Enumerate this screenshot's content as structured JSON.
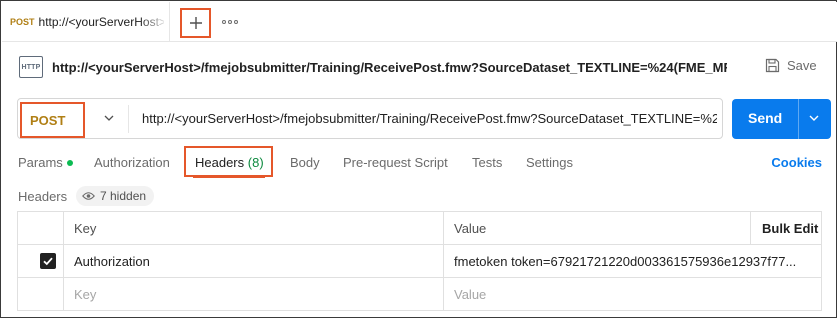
{
  "tab": {
    "method": "POST",
    "url": "http://<yourServerHost>/fmejobsubmitter/Training/ReceivePost.fmw"
  },
  "request": {
    "icon_label": "HTTP",
    "name": "http://<yourServerHost>/fmejobsubmitter/Training/ReceivePost.fmw?SourceDataset_TEXTLINE=%24(FME_MF_DI...",
    "save_label": "Save"
  },
  "urlbar": {
    "method": "POST",
    "url": "http://<yourServerHost>/fmejobsubmitter/Training/ReceivePost.fmw?SourceDataset_TEXTLINE=%2..."
  },
  "send_label": "Send",
  "req_tabs": {
    "params": "Params",
    "authorization": "Authorization",
    "headers": "Headers",
    "headers_count": "(8)",
    "body": "Body",
    "prerequest": "Pre-request Script",
    "tests": "Tests",
    "settings": "Settings",
    "cookies": "Cookies"
  },
  "headers_section": {
    "title": "Headers",
    "hidden": "7 hidden"
  },
  "table": {
    "columns": {
      "key": "Key",
      "value": "Value",
      "bulk_edit": "Bulk Edit"
    },
    "rows": [
      {
        "checked": true,
        "key": "Authorization",
        "value": "fmetoken token=67921721220d003361575936e12937f77..."
      }
    ],
    "placeholder": {
      "key": "Key",
      "value": "Value"
    }
  },
  "colors": {
    "accent_orange": "#e5572a",
    "method_post": "#b07f14",
    "send_blue": "#097bed",
    "status_green": "#0cbb52"
  }
}
